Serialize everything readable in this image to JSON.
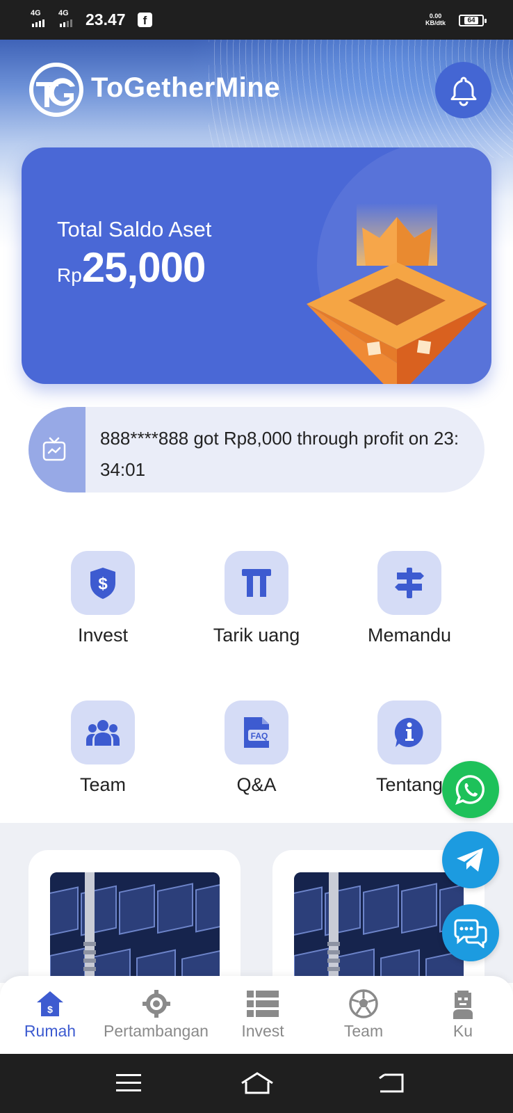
{
  "status_bar": {
    "network_1": "4G",
    "network_2": "4G",
    "time": "23.47",
    "app_icon": "facebook-icon",
    "speed_value": "0.00",
    "speed_unit": "KB/dtk",
    "battery": "64"
  },
  "header": {
    "logo_text": "TG",
    "brand": "ToGetherMine",
    "bell_icon": "bell-icon"
  },
  "balance": {
    "label": "Total Saldo Aset",
    "currency": "Rp",
    "amount": "25,000"
  },
  "notice": {
    "text": "888****888 got Rp8,000 through profit on 23:34:01"
  },
  "menu": [
    {
      "label": "Invest",
      "icon": "shield-dollar-icon"
    },
    {
      "label": "Tarik uang",
      "icon": "withdraw-icon"
    },
    {
      "label": "Memandu",
      "icon": "signpost-icon"
    },
    {
      "label": "Team",
      "icon": "users-icon"
    },
    {
      "label": "Q&A",
      "icon": "faq-icon"
    },
    {
      "label": "Tentang",
      "icon": "info-icon"
    }
  ],
  "floating_buttons": [
    "whatsapp-icon",
    "telegram-icon",
    "chat-icon"
  ],
  "bottom_nav": [
    {
      "label": "Rumah",
      "icon": "home-dollar-icon",
      "active": true
    },
    {
      "label": "Pertambangan",
      "icon": "mining-icon",
      "active": false
    },
    {
      "label": "Invest",
      "icon": "list-icon",
      "active": false
    },
    {
      "label": "Team",
      "icon": "football-icon",
      "active": false
    },
    {
      "label": "Ku",
      "icon": "profile-icon",
      "active": false
    }
  ],
  "colors": {
    "primary": "#4a68d6",
    "menu_tile": "#d5dcf6",
    "whatsapp": "#1ec15a",
    "telegram": "#1c9be0",
    "active_nav": "#3d5bd0"
  }
}
